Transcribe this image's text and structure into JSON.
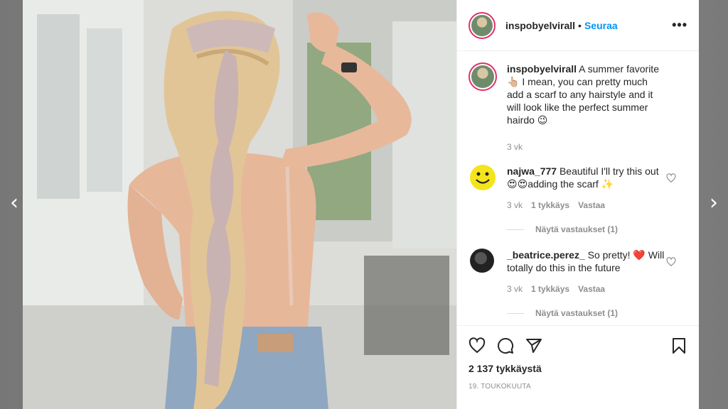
{
  "post": {
    "username": "inspobyelvirall",
    "follow_label": "Seuraa",
    "more_label": "•••"
  },
  "caption": {
    "username": "inspobyelvirall",
    "text": "A summer favorite 👆🏼 I mean, you can pretty much add a scarf to any hairstyle and it will look like the perfect summer hairdo 😉",
    "time": "3 vk"
  },
  "comments": [
    {
      "username": "najwa_777",
      "text": "Beautiful I'll try this out😍😍adding the scarf ✨",
      "time": "3 vk",
      "likes": "1 tykkäys",
      "reply_label": "Vastaa",
      "view_replies": "Näytä vastaukset (1)"
    },
    {
      "username": "_beatrice.perez_",
      "text": "So pretty! ❤️ Will totally do this in the future",
      "time": "3 vk",
      "likes": "1 tykkäys",
      "reply_label": "Vastaa",
      "view_replies": "Näytä vastaukset (1)"
    }
  ],
  "likes_count": "2 137 tykkäystä",
  "date": "19. TOUKOKUUTA",
  "nav": {
    "prev": "‹",
    "next": "›"
  },
  "icons": {
    "like": "heart-icon",
    "comment": "comment-icon",
    "share": "share-icon",
    "save": "bookmark-icon"
  },
  "colors": {
    "follow": "#0095f6",
    "heart": "#ed4956"
  }
}
